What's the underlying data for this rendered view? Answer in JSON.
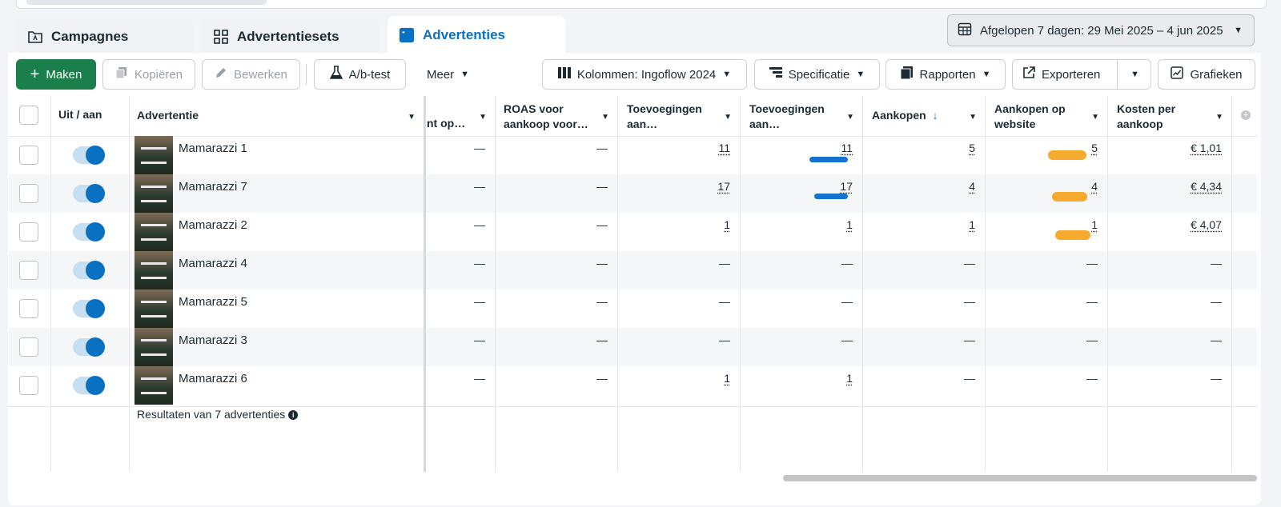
{
  "tabs": [
    {
      "label": "Campagnes",
      "icon": "campaign-icon"
    },
    {
      "label": "Advertentiesets",
      "icon": "adsets-grid-icon"
    },
    {
      "label": "Advertenties",
      "icon": "ads-icon",
      "active": true
    }
  ],
  "date_range": {
    "label": "Afgelopen 7 dagen: 29 Mei 2025 – 4 jun 2025",
    "icon": "calendar-icon"
  },
  "toolbar": {
    "create": "Maken",
    "copy": "Kopiëren",
    "edit": "Bewerken",
    "abtest": "A/b-test",
    "more": "Meer",
    "columns": "Kolommen: Ingoflow 2024",
    "breakdown": "Specificatie",
    "reports": "Rapporten",
    "export": "Exporteren",
    "charts": "Grafieken"
  },
  "table": {
    "headers": {
      "toggle": "Uit / aan",
      "ad": "Advertentie",
      "col1": "nt op…",
      "col2_l1": "ROAS voor",
      "col2_l2": "aankoop voor…",
      "col3_l1": "Toevoegingen",
      "col3_l2": "aan…",
      "col4_l1": "Toevoegingen",
      "col4_l2": "aan…",
      "col5": "Aankopen",
      "col6_l1": "Aankopen op",
      "col6_l2": "website",
      "col7_l1": "Kosten per",
      "col7_l2": "aankoop"
    },
    "rows": [
      {
        "name": "Mamarazzi 1",
        "c1": "—",
        "c2": "—",
        "c3": "11",
        "c4": "11",
        "c5": "5",
        "c6": "5",
        "c7": "€ 1,01"
      },
      {
        "name": "Mamarazzi 7",
        "c1": "—",
        "c2": "—",
        "c3": "17",
        "c4": "17",
        "c5": "4",
        "c6": "4",
        "c7": "€ 4,34"
      },
      {
        "name": "Mamarazzi 2",
        "c1": "—",
        "c2": "—",
        "c3": "1",
        "c4": "1",
        "c5": "1",
        "c6": "1",
        "c7": "€ 4,07"
      },
      {
        "name": "Mamarazzi 4",
        "c1": "—",
        "c2": "—",
        "c3": "—",
        "c4": "—",
        "c5": "—",
        "c6": "—",
        "c7": "—"
      },
      {
        "name": "Mamarazzi 5",
        "c1": "—",
        "c2": "—",
        "c3": "—",
        "c4": "—",
        "c5": "—",
        "c6": "—",
        "c7": "—"
      },
      {
        "name": "Mamarazzi 3",
        "c1": "—",
        "c2": "—",
        "c3": "—",
        "c4": "—",
        "c5": "—",
        "c6": "—",
        "c7": "—"
      },
      {
        "name": "Mamarazzi 6",
        "c1": "—",
        "c2": "—",
        "c3": "1",
        "c4": "1",
        "c5": "—",
        "c6": "—",
        "c7": "—"
      }
    ],
    "footer": "Resultaten van 7 advertenties"
  },
  "colors": {
    "accent": "#0a70c2",
    "create_button": "#1a7f4b",
    "highlight_blue": "#1473d1",
    "highlight_orange": "#f6ab2f"
  }
}
